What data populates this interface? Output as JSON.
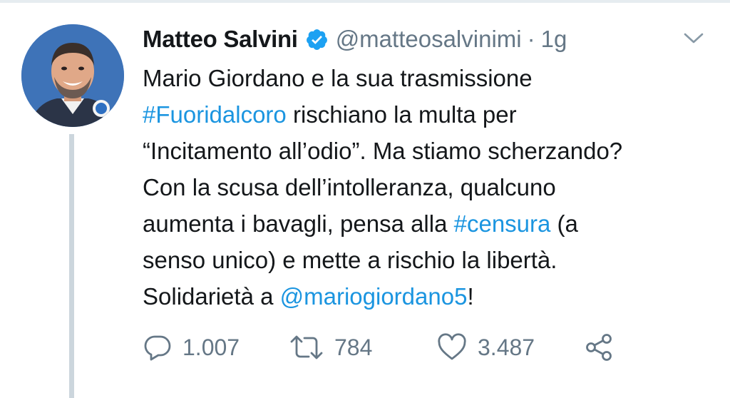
{
  "tweet": {
    "display_name": "Matteo Salvini",
    "handle": "@matteosalvinimi",
    "separator": "·",
    "time": "1g",
    "body": {
      "line1": "Mario Giordano e la sua trasmissione",
      "hashtag1": "#Fuoridalcoro",
      "line2_rest": " rischiano la multa per",
      "line3": "“Incitamento all’odio”. Ma stiamo scherzando?",
      "line4": "Con la scusa dell’intolleranza, qualcuno",
      "line5_pre": "aumenta i bavagli, pensa alla ",
      "hashtag2": "#censura",
      "line5_post": " (a",
      "line6": "senso unico) e mette a rischio la libertà.",
      "line7_pre": "Solidarietà a ",
      "mention": "@mariogiordano5",
      "line7_post": "!"
    },
    "actions": {
      "replies": "1.007",
      "retweets": "784",
      "likes": "3.487"
    },
    "icons": {
      "verified": "verified-badge-icon",
      "caret": "chevron-down-icon",
      "reply": "reply-bubble-icon",
      "retweet": "retweet-icon",
      "like": "heart-icon",
      "share": "share-icon"
    },
    "colors": {
      "text": "#14171a",
      "secondary": "#657786",
      "link": "#1b95e0",
      "verified": "#1da1f2",
      "thread_line": "#ccd6dd"
    }
  }
}
